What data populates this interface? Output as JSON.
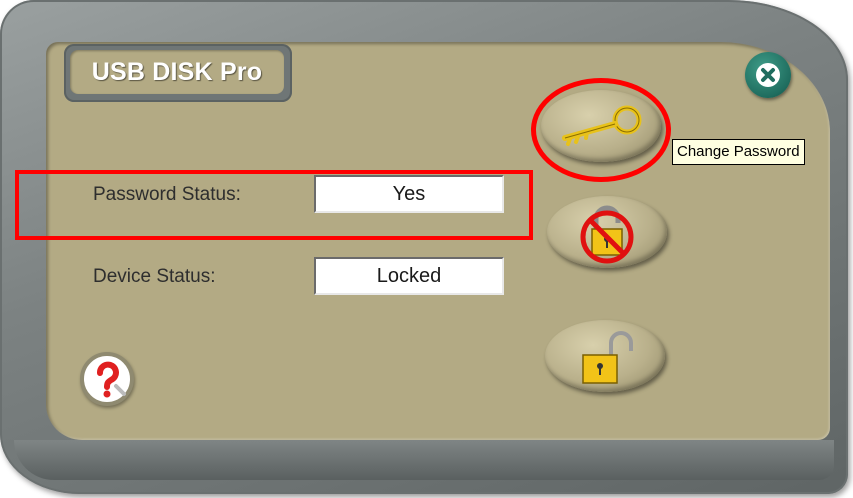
{
  "window": {
    "title": "USB DISK Pro"
  },
  "fields": {
    "password_status": {
      "label": "Password Status:",
      "value": "Yes"
    },
    "device_status": {
      "label": "Device Status:",
      "value": "Locked"
    }
  },
  "tooltip": {
    "text": "Change Password"
  },
  "icons": {
    "close": "close-icon",
    "change_password": "key-icon",
    "remove_password": "no-lock-icon",
    "unlock": "unlock-icon",
    "help": "help-icon"
  },
  "colors": {
    "panel": "#b3aa84",
    "frame": "#7c8282",
    "title_text": "#ffffff",
    "close_button": "#1f6d5f",
    "annotation": "#ff0000",
    "tooltip_bg": "#ffffe1"
  }
}
